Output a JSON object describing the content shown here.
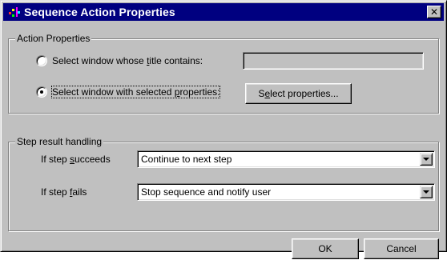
{
  "window": {
    "title": "Sequence Action Properties",
    "close_glyph": "✕"
  },
  "action_properties": {
    "group_label": "Action Properties",
    "radio_title": {
      "pre": "Select window whose ",
      "accel": "t",
      "post": "itle contains:",
      "selected": false
    },
    "title_input_value": "",
    "radio_selected": {
      "pre": "Select window with selected ",
      "accel": "p",
      "post": "roperties:",
      "selected": true
    },
    "select_properties_button": {
      "pre": "S",
      "accel": "e",
      "post": "lect properties..."
    }
  },
  "step_result": {
    "group_label": "Step result handling",
    "succeeds": {
      "pre": "If step ",
      "accel": "s",
      "post": "ucceeds",
      "value": "Continue to next step"
    },
    "fails": {
      "pre": "If step ",
      "accel": "f",
      "post": "ails",
      "value": "Stop sequence and notify user"
    }
  },
  "buttons": {
    "ok": "OK",
    "cancel": "Cancel"
  },
  "icons": {
    "title_icon": "sequence-app-icon",
    "dropdown_icon": "chevron-down-icon",
    "close_icon": "close-icon"
  },
  "colors": {
    "titlebar": "#000080",
    "face": "#c0c0c0"
  }
}
